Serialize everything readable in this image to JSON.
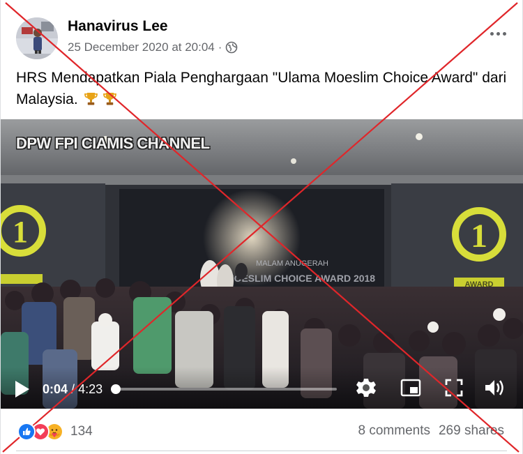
{
  "post": {
    "author": "Hanavirus Lee",
    "date": "25 December 2020 at 20:04",
    "separator": "·",
    "audience_icon": "globe-icon",
    "text_main": "HRS Mendapatkan Piala Penghargaan \"Ulama Moeslim Choice Award\" dari Malaysia.",
    "text_emoji": "trophy-icon trophy-icon"
  },
  "video": {
    "watermark": "DPW FPI CIAMIS CHANNEL",
    "stage_text_top": "MALAM ANUGERAH",
    "stage_text_bottom": "MOESLIM CHOICE AWARD 2018",
    "logo_number": "1",
    "logo_label": "AWARD",
    "current_time": "0:04",
    "time_separator": "/",
    "duration": "4:23",
    "progress_fraction": 0.0152,
    "icons": [
      "play-icon",
      "gear-icon",
      "picture-in-picture-icon",
      "fullscreen-icon",
      "volume-icon"
    ]
  },
  "engagement": {
    "reaction_icons": [
      "like-icon",
      "love-icon",
      "care-icon"
    ],
    "reaction_count": "134",
    "comments": "8 comments",
    "shares": "269 shares"
  },
  "colors": {
    "author_text": "#050505",
    "meta_text": "#65676b",
    "like_blue": "#1877f2",
    "love_red": "#f33e58",
    "care_yellow": "#f7b125",
    "overlay_red": "#e0262a"
  }
}
